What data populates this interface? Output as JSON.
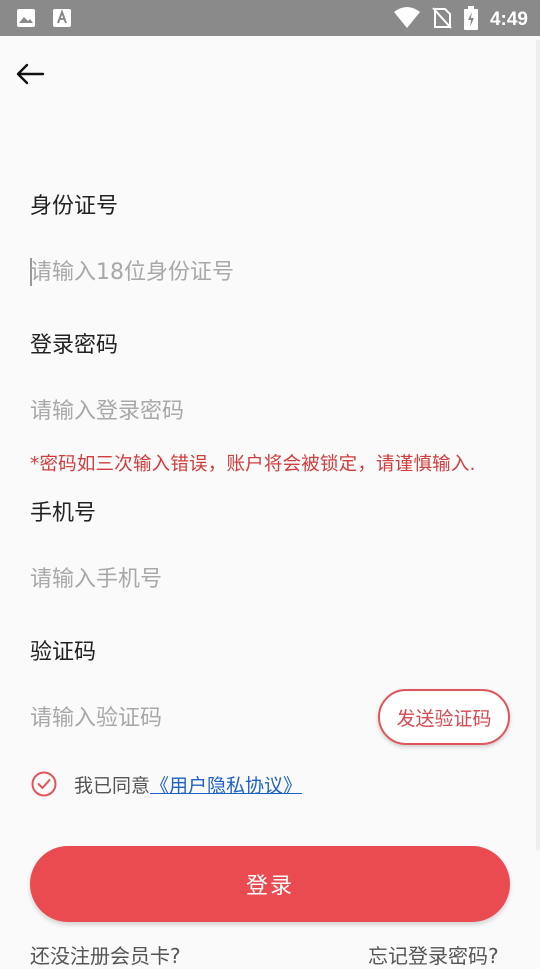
{
  "status_bar": {
    "time": "4:49",
    "icons": [
      "image-icon",
      "font-icon",
      "wifi-icon",
      "no-sim-icon",
      "battery-charging-icon"
    ]
  },
  "header": {
    "back_icon": "arrow-left-icon"
  },
  "form": {
    "id_label": "身份证号",
    "id_placeholder": "请输入18位身份证号",
    "password_label": "登录密码",
    "password_placeholder": "请输入登录密码",
    "password_warning": "*密码如三次输入错误，账户将会被锁定，请谨慎输入.",
    "phone_label": "手机号",
    "phone_placeholder": "请输入手机号",
    "code_label": "验证码",
    "code_placeholder": "请输入验证码",
    "send_code_label": "发送验证码"
  },
  "agreement": {
    "prefix": "我已同意",
    "link": "《用户隐私协议》",
    "checked": true
  },
  "login_button_label": "登录",
  "bottom": {
    "left_link": "还没注册会员卡?",
    "right_link": "忘记登录密码?"
  },
  "colors": {
    "accent": "#ea4b50",
    "warning": "#d23c3c",
    "link": "#1e62c8",
    "status_bar": "#8a8a8a"
  }
}
